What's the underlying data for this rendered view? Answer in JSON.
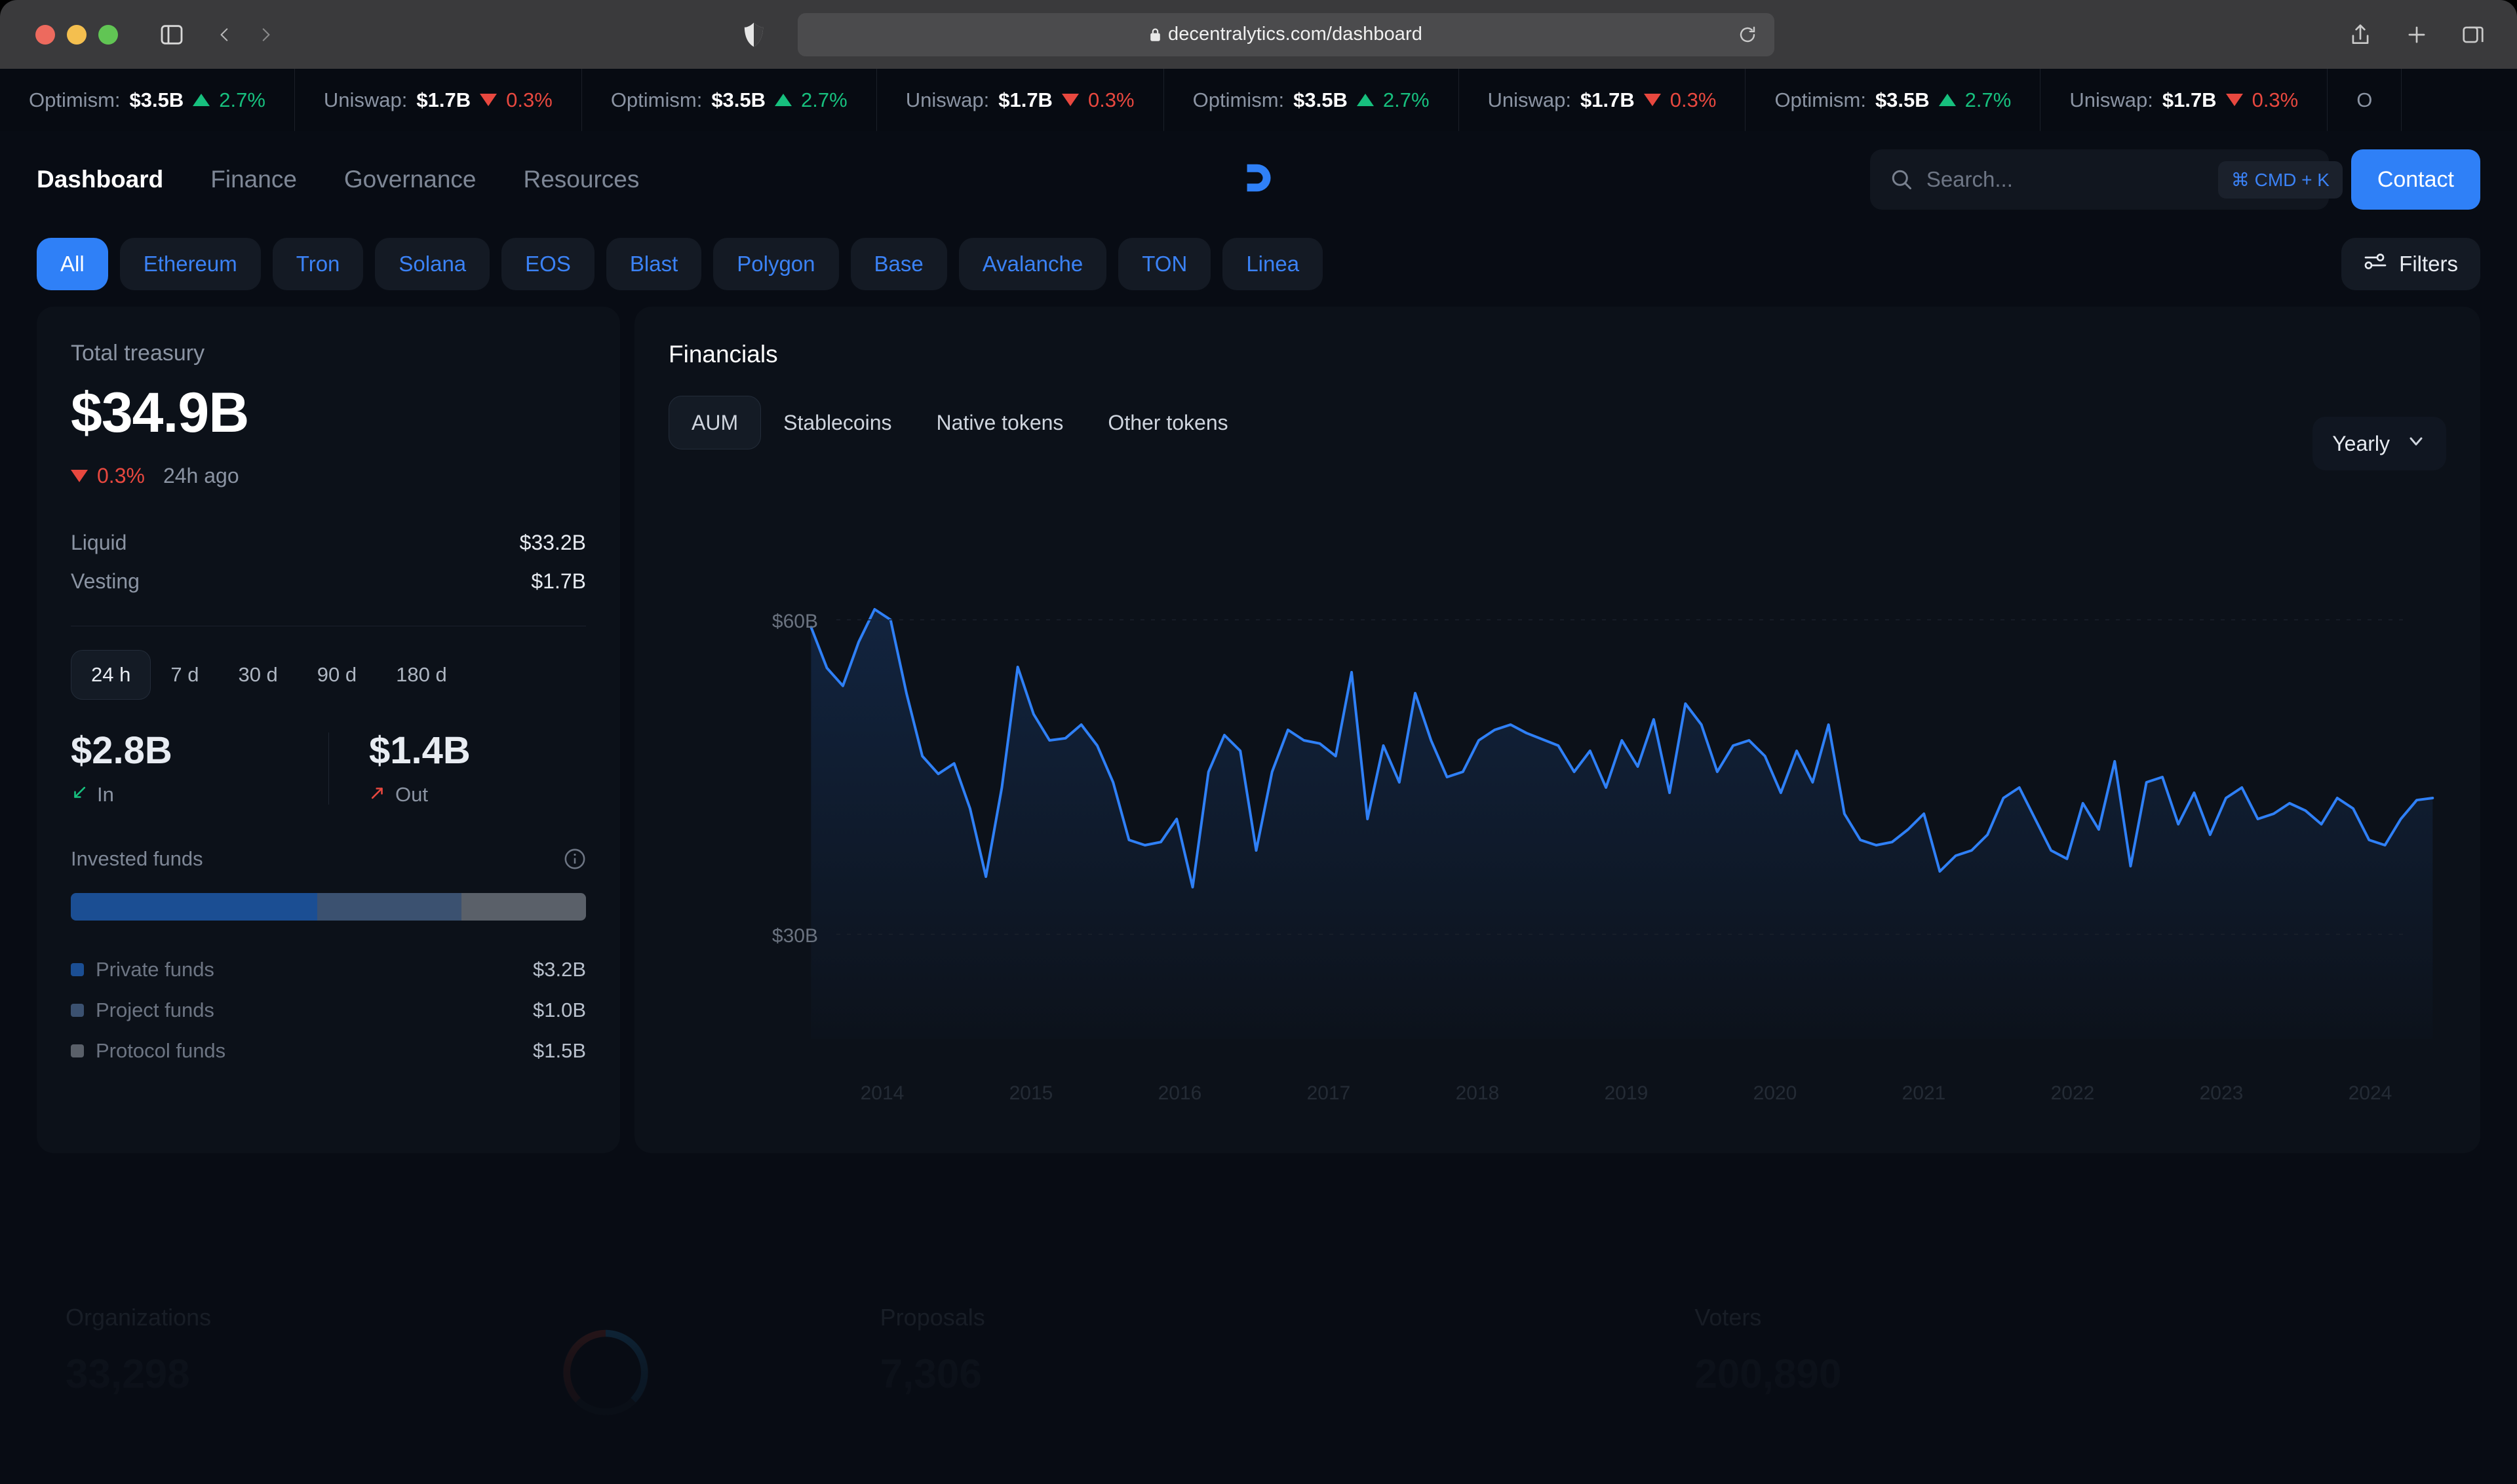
{
  "browser": {
    "url": "decentralytics.com/dashboard",
    "icons": {
      "sidebar_toggle": "sidebar-toggle-icon",
      "back": "back-arrow-icon",
      "forward": "forward-arrow-icon",
      "shield": "shield-icon",
      "lock": "lock-icon",
      "reload": "reload-icon",
      "share": "share-icon",
      "new_tab": "plus-icon",
      "tabs_overview": "tabs-overview-icon"
    }
  },
  "ticker": {
    "items": [
      {
        "name": "Optimism:",
        "value": "$3.5B",
        "dir": "up",
        "pct": "2.7%"
      },
      {
        "name": "Uniswap:",
        "value": "$1.7B",
        "dir": "down",
        "pct": "0.3%"
      },
      {
        "name": "Optimism:",
        "value": "$3.5B",
        "dir": "up",
        "pct": "2.7%"
      },
      {
        "name": "Uniswap:",
        "value": "$1.7B",
        "dir": "down",
        "pct": "0.3%"
      },
      {
        "name": "Optimism:",
        "value": "$3.5B",
        "dir": "up",
        "pct": "2.7%"
      },
      {
        "name": "Uniswap:",
        "value": "$1.7B",
        "dir": "down",
        "pct": "0.3%"
      },
      {
        "name": "Optimism:",
        "value": "$3.5B",
        "dir": "up",
        "pct": "2.7%"
      },
      {
        "name": "Uniswap:",
        "value": "$1.7B",
        "dir": "down",
        "pct": "0.3%"
      },
      {
        "name": "O",
        "value": "",
        "dir": "",
        "pct": ""
      }
    ]
  },
  "nav": {
    "links": [
      {
        "label": "Dashboard",
        "active": true
      },
      {
        "label": "Finance",
        "active": false
      },
      {
        "label": "Governance",
        "active": false
      },
      {
        "label": "Resources",
        "active": false
      }
    ],
    "logo_name": "decentralytics-logo",
    "search": {
      "placeholder": "Search...",
      "value": "",
      "shortcut": "⌘ CMD + K"
    },
    "contact_label": "Contact"
  },
  "chains": {
    "pills": [
      {
        "label": "All",
        "active": true
      },
      {
        "label": "Ethereum",
        "active": false
      },
      {
        "label": "Tron",
        "active": false
      },
      {
        "label": "Solana",
        "active": false
      },
      {
        "label": "EOS",
        "active": false
      },
      {
        "label": "Blast",
        "active": false
      },
      {
        "label": "Polygon",
        "active": false
      },
      {
        "label": "Base",
        "active": false
      },
      {
        "label": "Avalanche",
        "active": false
      },
      {
        "label": "TON",
        "active": false
      },
      {
        "label": "Linea",
        "active": false
      }
    ],
    "filters_label": "Filters"
  },
  "treasury": {
    "title": "Total treasury",
    "total": "$34.9B",
    "delta_pct": "0.3%",
    "delta_dir": "down",
    "delta_ago": "24h ago",
    "rows": [
      {
        "key": "Liquid",
        "value": "$33.2B"
      },
      {
        "key": "Vesting",
        "value": "$1.7B"
      }
    ],
    "ranges": [
      {
        "label": "24 h",
        "active": true
      },
      {
        "label": "7 d",
        "active": false
      },
      {
        "label": "30 d",
        "active": false
      },
      {
        "label": "90 d",
        "active": false
      },
      {
        "label": "180 d",
        "active": false
      }
    ],
    "flow_in": {
      "value": "$2.8B",
      "label": "In"
    },
    "flow_out": {
      "value": "$1.4B",
      "label": "Out"
    },
    "invested": {
      "title": "Invested funds",
      "segments": [
        {
          "label": "Private funds",
          "value": "$3.2B",
          "color": "#1b4e93",
          "pct": 47.8
        },
        {
          "label": "Project funds",
          "value": "$1.0B",
          "color": "#3b5170",
          "pct": 28.0
        },
        {
          "label": "Protocol funds",
          "value": "$1.5B",
          "color": "#5a6069",
          "pct": 24.2
        }
      ]
    }
  },
  "financials": {
    "title": "Financials",
    "tabs": [
      {
        "label": "AUM",
        "active": true
      },
      {
        "label": "Stablecoins",
        "active": false
      },
      {
        "label": "Native tokens",
        "active": false
      },
      {
        "label": "Other tokens",
        "active": false
      }
    ],
    "period": "Yearly"
  },
  "chart_data": {
    "type": "line",
    "title": "Financials — AUM",
    "xlabel": "",
    "ylabel": "",
    "ylim": [
      20,
      70
    ],
    "ytick_labels": [
      "$60B",
      "$30B"
    ],
    "ytick_values": [
      60,
      30
    ],
    "xtick_labels": [
      "2014",
      "2015",
      "2016",
      "2017",
      "2018",
      "2019",
      "2020",
      "2021",
      "2022",
      "2023",
      "2024"
    ],
    "xlim": [
      2013.6,
      2024.6
    ],
    "grid": false,
    "line_color": "#2f80f7",
    "fill": true,
    "series": [
      {
        "name": "AUM",
        "values": [
          59.3,
          55.4,
          53.7,
          57.9,
          61.0,
          60.0,
          53.0,
          47.0,
          45.3,
          46.3,
          42.0,
          35.5,
          44.0,
          55.5,
          51.0,
          48.5,
          48.7,
          50.0,
          48.0,
          44.5,
          39.0,
          38.5,
          38.8,
          41.0,
          34.5,
          45.5,
          49.0,
          47.5,
          38.0,
          45.5,
          49.5,
          48.5,
          48.2,
          47.0,
          55.0,
          41.0,
          48.0,
          44.5,
          53.0,
          48.5,
          45.0,
          45.5,
          48.5,
          49.5,
          50.0,
          49.2,
          48.6,
          48.0,
          45.5,
          47.5,
          44.0,
          48.5,
          46.0,
          50.5,
          43.5,
          52.0,
          50.0,
          45.5,
          48.0,
          48.5,
          47.0,
          43.5,
          47.5,
          44.5,
          50.0,
          41.5,
          39.0,
          38.5,
          38.8,
          40.0,
          41.5,
          36.0,
          37.5,
          38.0,
          39.5,
          43.0,
          44.0,
          41.0,
          38.0,
          37.2,
          42.5,
          40.0,
          46.5,
          36.5,
          44.5,
          45.0,
          40.5,
          43.5,
          39.5,
          43.0,
          44.0,
          41.0,
          41.5,
          42.5,
          41.8,
          40.5,
          43.0,
          42.0,
          39.0,
          38.5,
          41.0,
          42.8,
          43.0
        ]
      }
    ]
  },
  "bottom_stats": [
    {
      "label": "Organizations",
      "value": "33,298"
    },
    {
      "label": "Proposals",
      "value": "7,306"
    },
    {
      "label": "Voters",
      "value": "200,890"
    }
  ]
}
